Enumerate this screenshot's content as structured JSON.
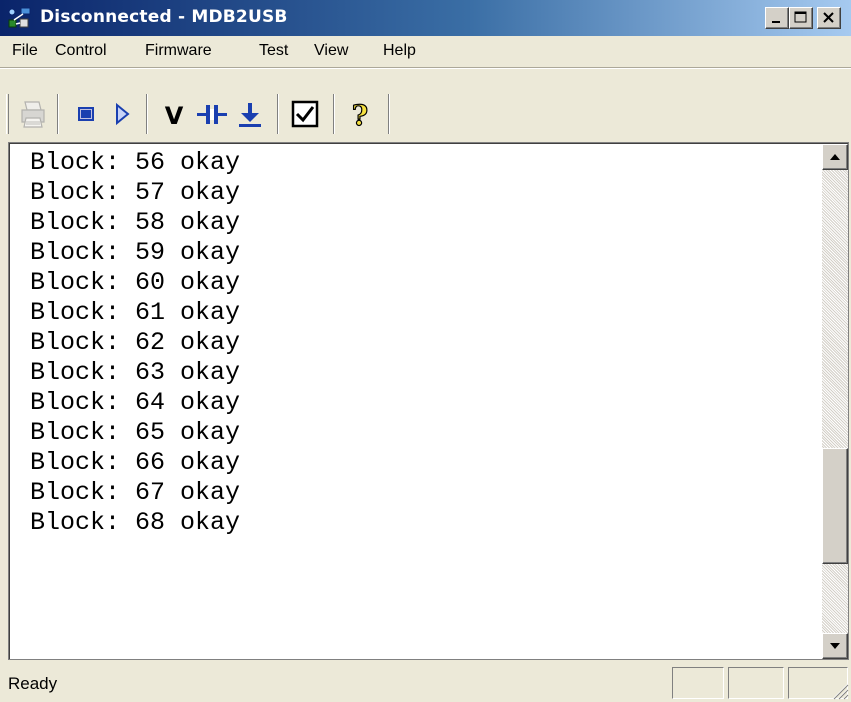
{
  "window": {
    "title": "Disconnected - MDB2USB",
    "app_icon": "mdb2usb-app-icon",
    "caption_buttons": [
      "minimize-icon",
      "maximize-icon",
      "close-icon"
    ]
  },
  "menu": {
    "items": [
      "File",
      "Control",
      "Firmware",
      "Test",
      "View",
      "Help"
    ]
  },
  "toolbar": {
    "buttons": [
      {
        "icon": "printer-icon",
        "enabled": false
      },
      {
        "icon": "stop-icon",
        "enabled": true
      },
      {
        "icon": "play-icon",
        "enabled": true
      },
      {
        "icon": "verify-icon",
        "enabled": true
      },
      {
        "icon": "connect-icon",
        "enabled": true
      },
      {
        "icon": "download-icon",
        "enabled": true
      },
      {
        "icon": "checkbox-icon",
        "enabled": true
      },
      {
        "icon": "help-icon",
        "enabled": true
      }
    ],
    "verify_glyph": "V",
    "help_glyph": "?"
  },
  "log": {
    "lines": [
      "Block: 56 okay",
      "Block: 57 okay",
      "Block: 58 okay",
      "Block: 59 okay",
      "Block: 60 okay",
      "Block: 61 okay",
      "Block: 62 okay",
      "Block: 63 okay",
      "Block: 64 okay",
      "Block: 65 okay",
      "Block: 66 okay",
      "Block: 67 okay",
      "Block: 68 okay"
    ]
  },
  "scrollbar": {
    "position_fraction": 0.8,
    "thumb_fraction": 0.25
  },
  "status": {
    "text": "Ready"
  },
  "colors": {
    "titlebar_start": "#0a246a",
    "titlebar_end": "#a6caf0",
    "window_face": "#ece9d8",
    "toolbar_icon_blue": "#1a3fb0"
  }
}
